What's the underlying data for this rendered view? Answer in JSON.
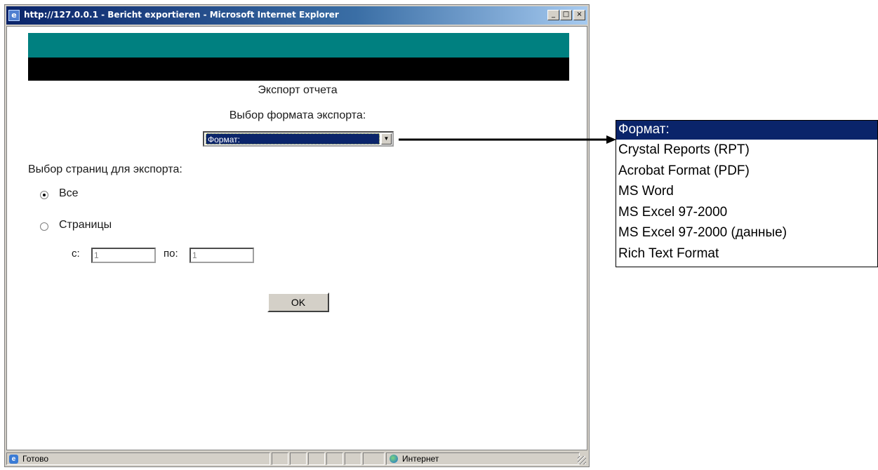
{
  "window": {
    "title": "http://127.0.0.1 - Bericht exportieren - Microsoft Internet Explorer",
    "buttons": {
      "minimize": "_",
      "maximize": "□",
      "close": "×"
    }
  },
  "page": {
    "heading": "Экспорт отчета",
    "format_label": "Выбор формата экспорта:",
    "format_select": {
      "selected": "Формат:"
    },
    "pages_label": "Выбор страниц для экспорта:",
    "radio_all": {
      "label": "Все",
      "checked": true
    },
    "radio_pages": {
      "label": "Страницы",
      "checked": false
    },
    "from_label": "с:",
    "from_value": "1",
    "to_label": "по:",
    "to_value": "1",
    "ok_button": "OK"
  },
  "statusbar": {
    "status": "Готово",
    "zone": "Интернет"
  },
  "dropdown": {
    "options": [
      "Формат:",
      "Crystal Reports (RPT)",
      "Acrobat Format (PDF)",
      "MS Word",
      "MS Excel 97-2000",
      "MS Excel 97-2000 (данные)",
      "Rich Text Format"
    ]
  },
  "colors": {
    "banner_teal": "#008080",
    "banner_black": "#000000",
    "selection": "#0a246a",
    "window_chrome": "#d4d0c8"
  }
}
